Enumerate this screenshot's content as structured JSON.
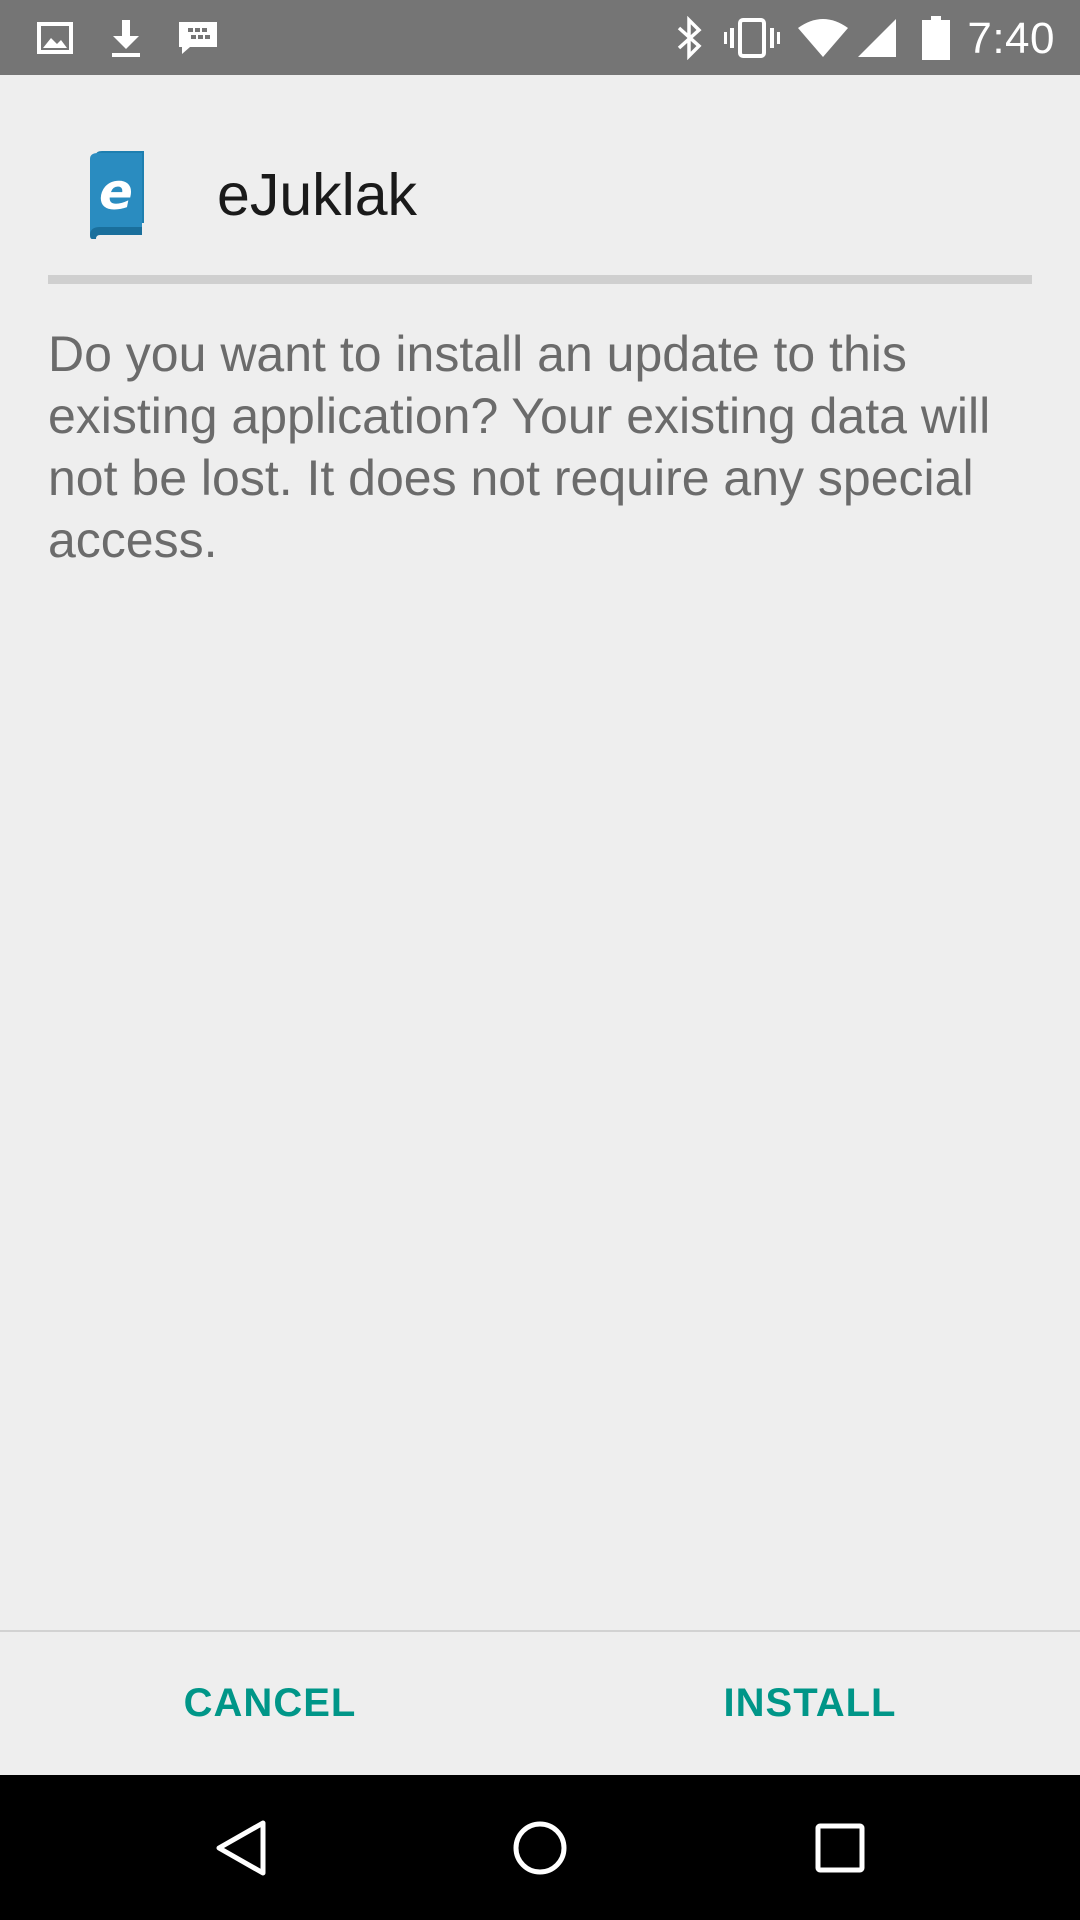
{
  "status_bar": {
    "time": "7:40",
    "left_icons": [
      "image-icon",
      "download-icon",
      "messenger-icon"
    ],
    "right_icons": [
      "bluetooth-icon",
      "vibrate-icon",
      "wifi-icon",
      "signal-icon",
      "battery-icon"
    ]
  },
  "dialog": {
    "app_name": "eJuklak",
    "message": "Do you want to install an update to this existing application? Your existing data will not be lost. It does not require any special access.",
    "cancel_label": "CANCEL",
    "install_label": "INSTALL"
  },
  "colors": {
    "accent": "#009688",
    "status_bar": "#757575",
    "background": "#eeeeee",
    "app_icon": "#1e7fb0"
  },
  "nav_bar": {
    "buttons": [
      "back-icon",
      "home-icon",
      "recents-icon"
    ]
  }
}
